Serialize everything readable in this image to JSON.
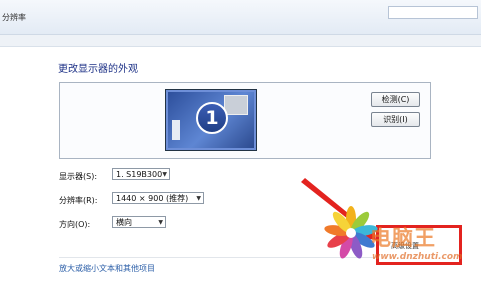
{
  "breadcrumb": "分辨率",
  "page_heading": "更改显示器的外观",
  "preview": {
    "monitor_number": "1",
    "detect_label": "检测(C)",
    "identify_label": "识别(I)"
  },
  "settings": {
    "display_label": "显示器(S):",
    "display_value": "1. S19B300",
    "resolution_label": "分辨率(R):",
    "resolution_value": "1440 × 900 (推荐)",
    "orientation_label": "方向(O):",
    "orientation_value": "横向"
  },
  "advanced_settings_label": "高级设置",
  "bottom_link": "放大或缩小文本和其他项目",
  "watermark": {
    "text": "电脑王",
    "url": "www.dnzhuti.com"
  },
  "colors": {
    "highlight_box": "#e3231f",
    "heading": "#1e3287",
    "link": "#2c5fa8",
    "arrow": "#e3231f"
  },
  "icons": [
    "caret-down-icon",
    "flower-logo-icon",
    "red-arrow-icon"
  ]
}
